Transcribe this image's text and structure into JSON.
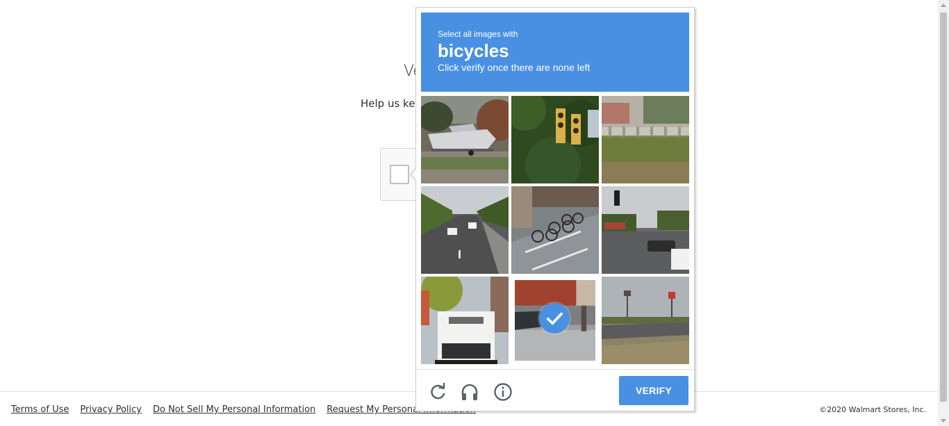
{
  "page": {
    "title": "Ve",
    "subtitle": "Help us kee"
  },
  "challenge": {
    "prompt": "Select all images with",
    "keyword": "bicycles",
    "instruction": "Click verify once there are none left",
    "verify_label": "VERIFY",
    "header_color": "#4a90e2",
    "tiles": [
      {
        "scene": "boat on trailer",
        "selected": false
      },
      {
        "scene": "traffic lights in trees",
        "selected": false
      },
      {
        "scene": "grass field and fence",
        "selected": false
      },
      {
        "scene": "highway with cars",
        "selected": false
      },
      {
        "scene": "bicycles parked on street",
        "selected": false
      },
      {
        "scene": "intersection with traffic light",
        "selected": false
      },
      {
        "scene": "truck front",
        "selected": false
      },
      {
        "scene": "street with parked car",
        "selected": true
      },
      {
        "scene": "roadside with water tower",
        "selected": false
      }
    ],
    "controls": [
      "reload-icon",
      "headphones-icon",
      "info-icon"
    ]
  },
  "footer": {
    "links": [
      "Terms of Use",
      "Privacy Policy",
      "Do Not Sell My Personal Information",
      "Request My Personal Information"
    ],
    "copyright": "©2020 Walmart Stores, Inc."
  }
}
